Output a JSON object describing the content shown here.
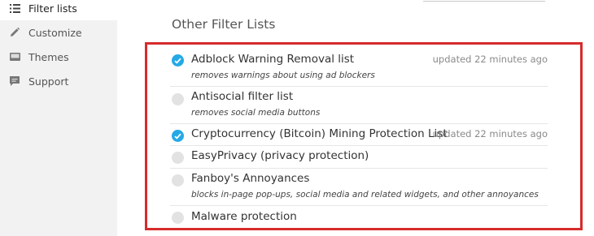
{
  "sidebar": {
    "items": [
      {
        "label": "Filter lists",
        "icon": "list-icon",
        "active": true
      },
      {
        "label": "Customize",
        "icon": "pencil-icon",
        "active": false
      },
      {
        "label": "Themes",
        "icon": "image-icon",
        "active": false
      },
      {
        "label": "Support",
        "icon": "chat-icon",
        "active": false
      }
    ]
  },
  "main": {
    "section_title": "Other Filter Lists",
    "filters": [
      {
        "name": "Adblock Warning Removal list",
        "updated": "updated 22 minutes ago",
        "description": "removes warnings about using ad blockers",
        "checked": true
      },
      {
        "name": "Antisocial filter list",
        "updated": "",
        "description": "removes social media buttons",
        "checked": false
      },
      {
        "name": "Cryptocurrency (Bitcoin) Mining Protection List",
        "updated": "updated 22 minutes ago",
        "description": "",
        "checked": true
      },
      {
        "name": "EasyPrivacy (privacy protection)",
        "updated": "",
        "description": "",
        "checked": false
      },
      {
        "name": "Fanboy's Annoyances",
        "updated": "",
        "description": "blocks in-page pop-ups, social media and related widgets, and other annoyances",
        "checked": false
      },
      {
        "name": "Malware protection",
        "updated": "",
        "description": "",
        "checked": false
      }
    ]
  },
  "colors": {
    "accent": "#25a9e6",
    "highlight_border": "#d62b2b",
    "sidebar_bg": "#f2f2f2"
  }
}
